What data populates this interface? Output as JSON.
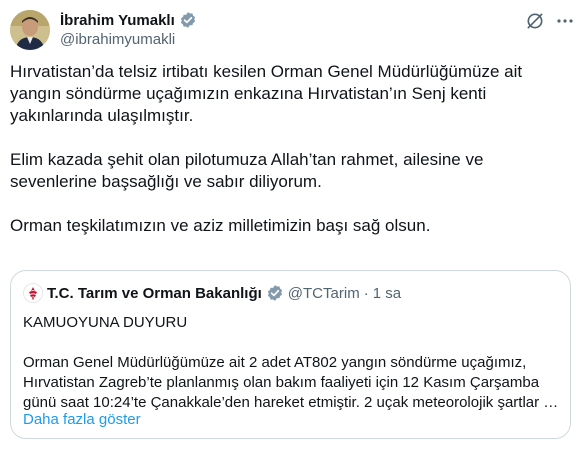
{
  "author": {
    "name": "İbrahim Yumaklı",
    "handle": "@ibrahimyumakli"
  },
  "tweet": {
    "paragraphs": [
      "Hırvatistan’da telsiz irtibatı kesilen Orman Genel Müdürlüğümüze ait yangın söndürme uçağımızın enkazına Hırvatistan’ın Senj kenti yakınlarında ulaşılmıştır.",
      "Elim kazada şehit olan pilotumuza Allah’tan rahmet, ailesine ve sevenlerine başsağlığı ve sabır diliyorum.",
      "Orman teşkilatımızın ve aziz milletimizin başı sağ olsun."
    ]
  },
  "quoted": {
    "name": "T.C. Tarım ve Orman Bakanlığı",
    "handle": "@TCTarim",
    "separator": "·",
    "time": "1 sa",
    "heading": "KAMUOYUNA DUYURU",
    "text": "Orman Genel Müdürlüğümüze ait 2 adet AT802 yangın söndürme uçağımız, Hırvatistan Zagreb’te planlanmış olan bakım faaliyeti için 12 Kasım Çarşamba günü saat 10:24’te Çanakkale’den hareket etmiştir. 2 uçak meteorolojik şartlar …",
    "show_more": "Daha fazla göster"
  },
  "colors": {
    "accent": "#1d9bf0",
    "verified": "#829aab",
    "secondary_text": "#536471",
    "border": "#cfd9de"
  },
  "icons": {
    "verified": "verified-badge-icon",
    "grok": "grok-icon",
    "more": "more-options-icon"
  }
}
